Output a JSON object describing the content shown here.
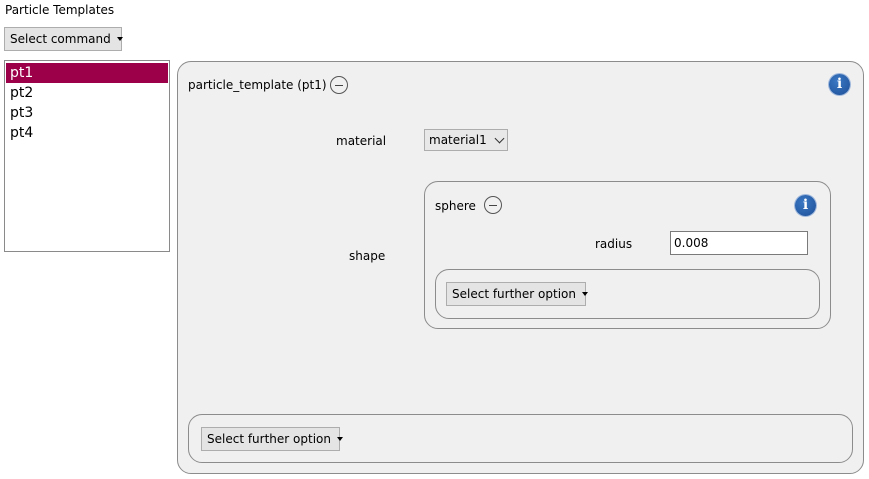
{
  "title": "Particle Templates",
  "command_menu": {
    "label": "Select command"
  },
  "templates_list": [
    "pt1",
    "pt2",
    "pt3",
    "pt4"
  ],
  "selected_template": "pt1",
  "particle_template": {
    "header": "particle_template (pt1)",
    "material_label": "material",
    "material_value": "material1",
    "shape_label": "shape",
    "sphere": {
      "header": "sphere",
      "radius_label": "radius",
      "radius_value": "0.008",
      "further_option": "Select further option"
    },
    "further_option": "Select further option"
  },
  "icons": {
    "info": "info-icon",
    "collapse": "minus-circle-icon",
    "dropdown": "caret-down-icon"
  },
  "colors": {
    "selection": "#9b0048",
    "panel_bg": "#f0f0f0",
    "info_blue": "#1d4f97"
  }
}
